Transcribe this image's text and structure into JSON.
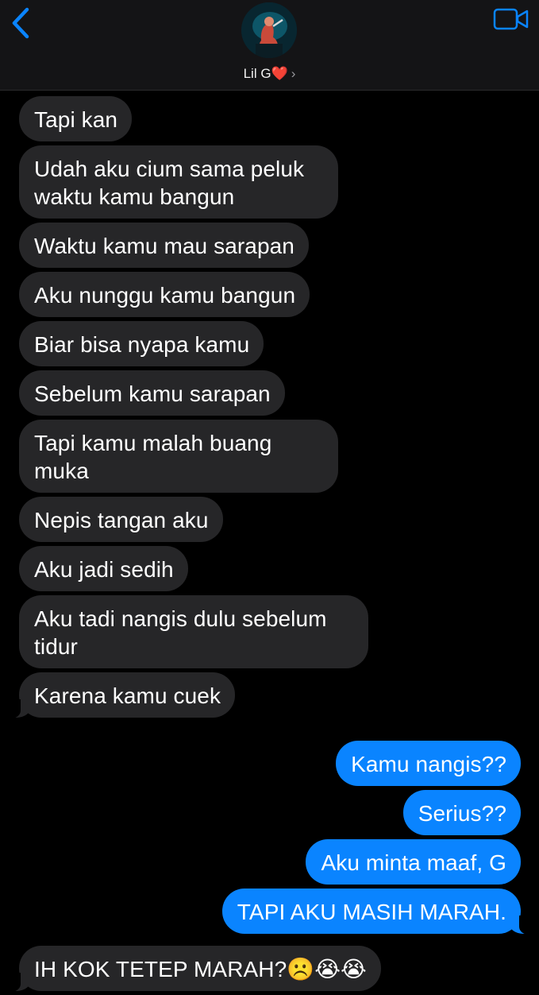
{
  "header": {
    "contact_name": "Lil G",
    "contact_emoji": "❤️",
    "chevron": "›",
    "back_icon": "chevron-left-icon",
    "video_icon": "video-camera-icon",
    "accent_color": "#0a84ff"
  },
  "messages": [
    {
      "from": "them",
      "text": "Tapi kan"
    },
    {
      "from": "them",
      "text": "Udah aku cium sama peluk waktu kamu bangun"
    },
    {
      "from": "them",
      "text": "Waktu kamu mau sarapan"
    },
    {
      "from": "them",
      "text": "Aku nunggu kamu bangun"
    },
    {
      "from": "them",
      "text": "Biar bisa nyapa kamu"
    },
    {
      "from": "them",
      "text": "Sebelum kamu sarapan"
    },
    {
      "from": "them",
      "text": "Tapi kamu malah buang muka"
    },
    {
      "from": "them",
      "text": "Nepis tangan aku"
    },
    {
      "from": "them",
      "text": "Aku jadi sedih"
    },
    {
      "from": "them",
      "text": "Aku tadi nangis dulu sebelum tidur"
    },
    {
      "from": "them",
      "text": "Karena kamu cuek"
    },
    {
      "from": "me",
      "text": "Kamu nangis??"
    },
    {
      "from": "me",
      "text": "Serius??"
    },
    {
      "from": "me",
      "text": "Aku minta maaf, G"
    },
    {
      "from": "me",
      "text": "TAPI AKU MASIH MARAH."
    },
    {
      "from": "them",
      "text": "IH KOK TETEP MARAH?☹️😭😭"
    }
  ]
}
